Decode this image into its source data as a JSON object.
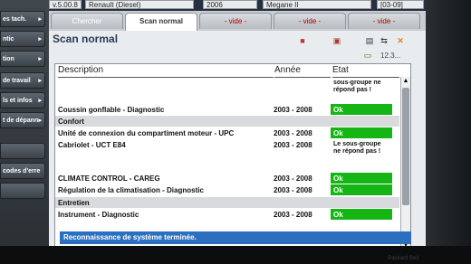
{
  "app": {
    "topbar": {
      "version": "v.5.00.8",
      "vehicle_combo": "Renault (Diesel)",
      "year_combo": "2006",
      "model_combo": "Megane II",
      "date_fragment": "[03-09]"
    },
    "sidebar": {
      "items": [
        {
          "label": "es tach."
        },
        {
          "label": "ntic"
        },
        {
          "label": "tion"
        },
        {
          "label": "de travail"
        },
        {
          "label": "ls et infos"
        },
        {
          "label": "t de dépann"
        },
        {
          "label": ""
        },
        {
          "label": "codes d'erre"
        },
        {
          "label": ""
        }
      ]
    },
    "tabs": [
      {
        "label": "Chercher"
      },
      {
        "label": "Scan normal"
      },
      {
        "label": "- vide -"
      },
      {
        "label": "- vide -"
      },
      {
        "label": "- vide -"
      }
    ],
    "page_title": "Scan normal",
    "counter": "12.3...",
    "table": {
      "headers": {
        "description": "Description",
        "annee": "Année",
        "etat": "Etat"
      },
      "rows": [
        {
          "desc": "",
          "year": "",
          "state": "sous-groupe ne répond pas !",
          "type": "normal",
          "ok": false
        },
        {
          "desc": "Coussin gonflable - Diagnostic",
          "year": "2003 - 2008",
          "state": "Ok",
          "type": "normal",
          "ok": true
        },
        {
          "desc": "Confort",
          "year": "",
          "state": "",
          "type": "section",
          "ok": false
        },
        {
          "desc": "Unité de connexion du compartiment moteur - UPC",
          "year": "2003 - 2008",
          "state": "Ok",
          "type": "normal",
          "ok": true
        },
        {
          "desc": "Cabriolet - UCT E84",
          "year": "2003 - 2008",
          "state": "Le sous-groupe ne répond pas !",
          "type": "normal",
          "ok": false
        },
        {
          "desc": "CLIMATE CONTROL - CAREG",
          "year": "2003 - 2008",
          "state": "Ok",
          "type": "normal",
          "ok": true
        },
        {
          "desc": "Régulation de la climatisation - Diagnostic",
          "year": "2003 - 2008",
          "state": "Ok",
          "type": "normal",
          "ok": true
        },
        {
          "desc": "Entretien",
          "year": "",
          "state": "",
          "type": "section",
          "ok": false
        },
        {
          "desc": "Instrument - Diagnostic",
          "year": "2003 - 2008",
          "state": "Ok",
          "type": "normal",
          "ok": true
        }
      ]
    },
    "status": "Reconnaissance de système terminée.",
    "brand": "Packard Bell"
  }
}
